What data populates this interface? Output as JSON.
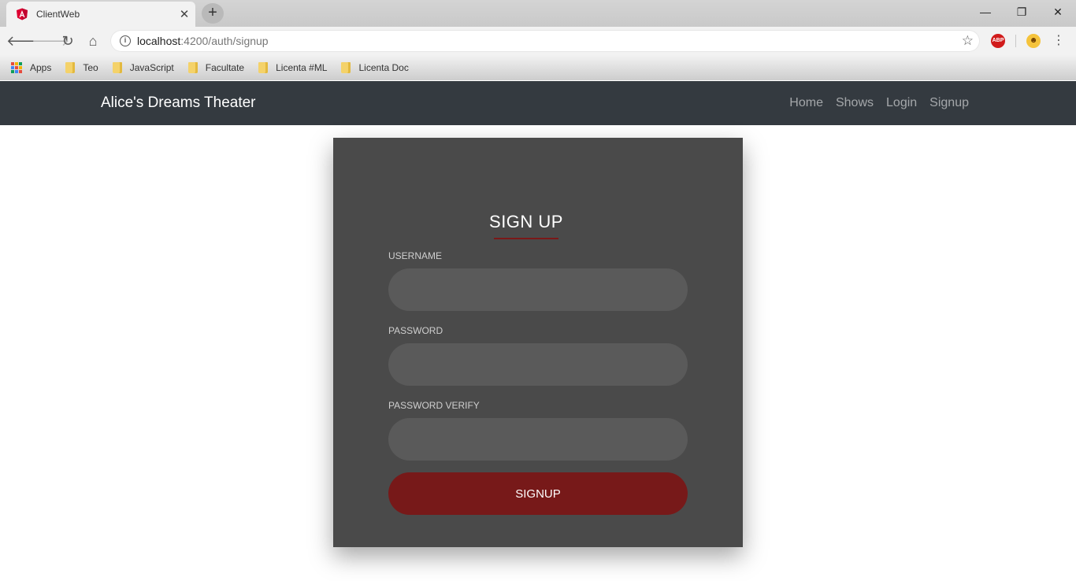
{
  "browser": {
    "tab_title": "ClientWeb",
    "tab_close": "✕",
    "new_tab": "+",
    "window_controls": {
      "minimize": "—",
      "maximize": "❐",
      "close": "✕"
    },
    "url_host": "localhost",
    "url_rest": ":4200/auth/signup",
    "abp_label": "ABP",
    "bookmarks": [
      {
        "label": "Apps",
        "icon": "apps-icon"
      },
      {
        "label": "Teo",
        "icon": "folder-icon"
      },
      {
        "label": "JavaScript",
        "icon": "folder-icon"
      },
      {
        "label": "Facultate",
        "icon": "folder-icon"
      },
      {
        "label": "Licenta #ML",
        "icon": "folder-icon"
      },
      {
        "label": "Licenta Doc",
        "icon": "folder-icon"
      }
    ]
  },
  "navbar": {
    "brand": "Alice's Dreams Theater",
    "links": [
      "Home",
      "Shows",
      "Login",
      "Signup"
    ]
  },
  "form": {
    "title": "SIGN UP",
    "username_label": "USERNAME",
    "username_value": "",
    "password_label": "PASSWORD",
    "password_value": "",
    "password_verify_label": "PASSWORD VERIFY",
    "password_verify_value": "",
    "submit_label": "SIGNUP"
  },
  "colors": {
    "navbar_bg": "#343a40",
    "card_bg": "#4a4a4a",
    "input_bg": "#5a5a5a",
    "accent": "#771919"
  }
}
